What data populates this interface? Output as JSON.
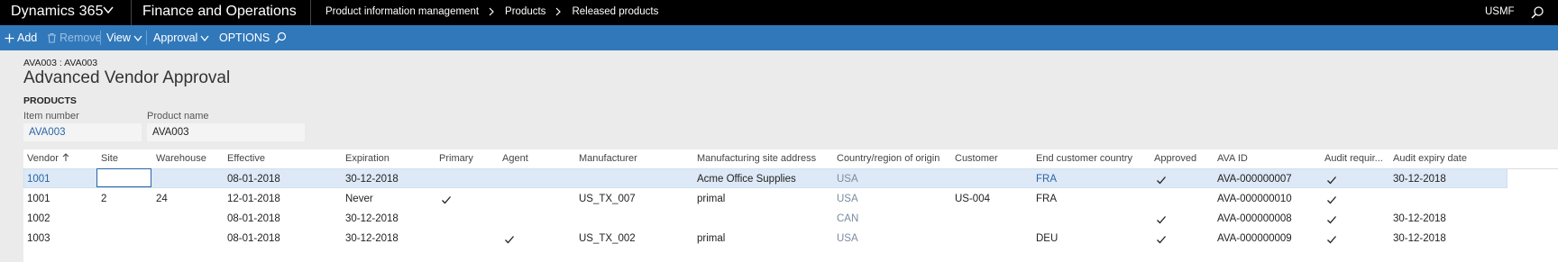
{
  "topbar": {
    "brand": "Dynamics 365",
    "module": "Finance and Operations",
    "breadcrumbs": [
      "Product information management",
      "Products",
      "Released products"
    ],
    "company": "USMF"
  },
  "actions": {
    "add": "Add",
    "remove": "Remove",
    "view": "View",
    "approval": "Approval",
    "options": "OPTIONS"
  },
  "record": {
    "id": "AVA003 : AVA003",
    "title": "Advanced Vendor Approval",
    "section": "PRODUCTS",
    "item_number_label": "Item number",
    "item_number": "AVA003",
    "product_name_label": "Product name",
    "product_name": "AVA003"
  },
  "grid": {
    "columns": [
      "Vendor",
      "Site",
      "Warehouse",
      "Effective",
      "Expiration",
      "Primary",
      "Agent",
      "Manufacturer",
      "Manufacturing site address",
      "Country/region of origin",
      "Customer",
      "End customer country",
      "Approved",
      "AVA ID",
      "Audit requir...",
      "Audit expiry date"
    ],
    "rows": [
      {
        "vendor": "1001",
        "site": "",
        "warehouse": "",
        "effective": "08-01-2018",
        "expiration": "30-12-2018",
        "primary": false,
        "agent": false,
        "manufacturer": "",
        "site_address": "Acme Office Supplies",
        "origin": "USA",
        "customer": "",
        "end_country": "FRA",
        "approved": true,
        "ava_id": "AVA-000000007",
        "audit_required": true,
        "audit_expiry": "30-12-2018"
      },
      {
        "vendor": "1001",
        "site": "2",
        "warehouse": "24",
        "effective": "12-01-2018",
        "expiration": "Never",
        "primary": true,
        "agent": false,
        "manufacturer": "US_TX_007",
        "site_address": "primal",
        "origin": "USA",
        "customer": "US-004",
        "end_country": "FRA",
        "approved": false,
        "ava_id": "AVA-000000010",
        "audit_required": true,
        "audit_expiry": ""
      },
      {
        "vendor": "1002",
        "site": "",
        "warehouse": "",
        "effective": "08-01-2018",
        "expiration": "30-12-2018",
        "primary": false,
        "agent": false,
        "manufacturer": "",
        "site_address": "",
        "origin": "CAN",
        "customer": "",
        "end_country": "",
        "approved": true,
        "ava_id": "AVA-000000008",
        "audit_required": true,
        "audit_expiry": "30-12-2018"
      },
      {
        "vendor": "1003",
        "site": "",
        "warehouse": "",
        "effective": "08-01-2018",
        "expiration": "30-12-2018",
        "primary": false,
        "agent": true,
        "manufacturer": "US_TX_002",
        "site_address": "primal",
        "origin": "USA",
        "customer": "",
        "end_country": "DEU",
        "approved": true,
        "ava_id": "AVA-000000009",
        "audit_required": true,
        "audit_expiry": "30-12-2018"
      }
    ]
  },
  "colors": {
    "topbar": "#000000",
    "actionbar": "#3178ba",
    "link": "#2a64a8",
    "selected_row": "#dde9f6"
  }
}
